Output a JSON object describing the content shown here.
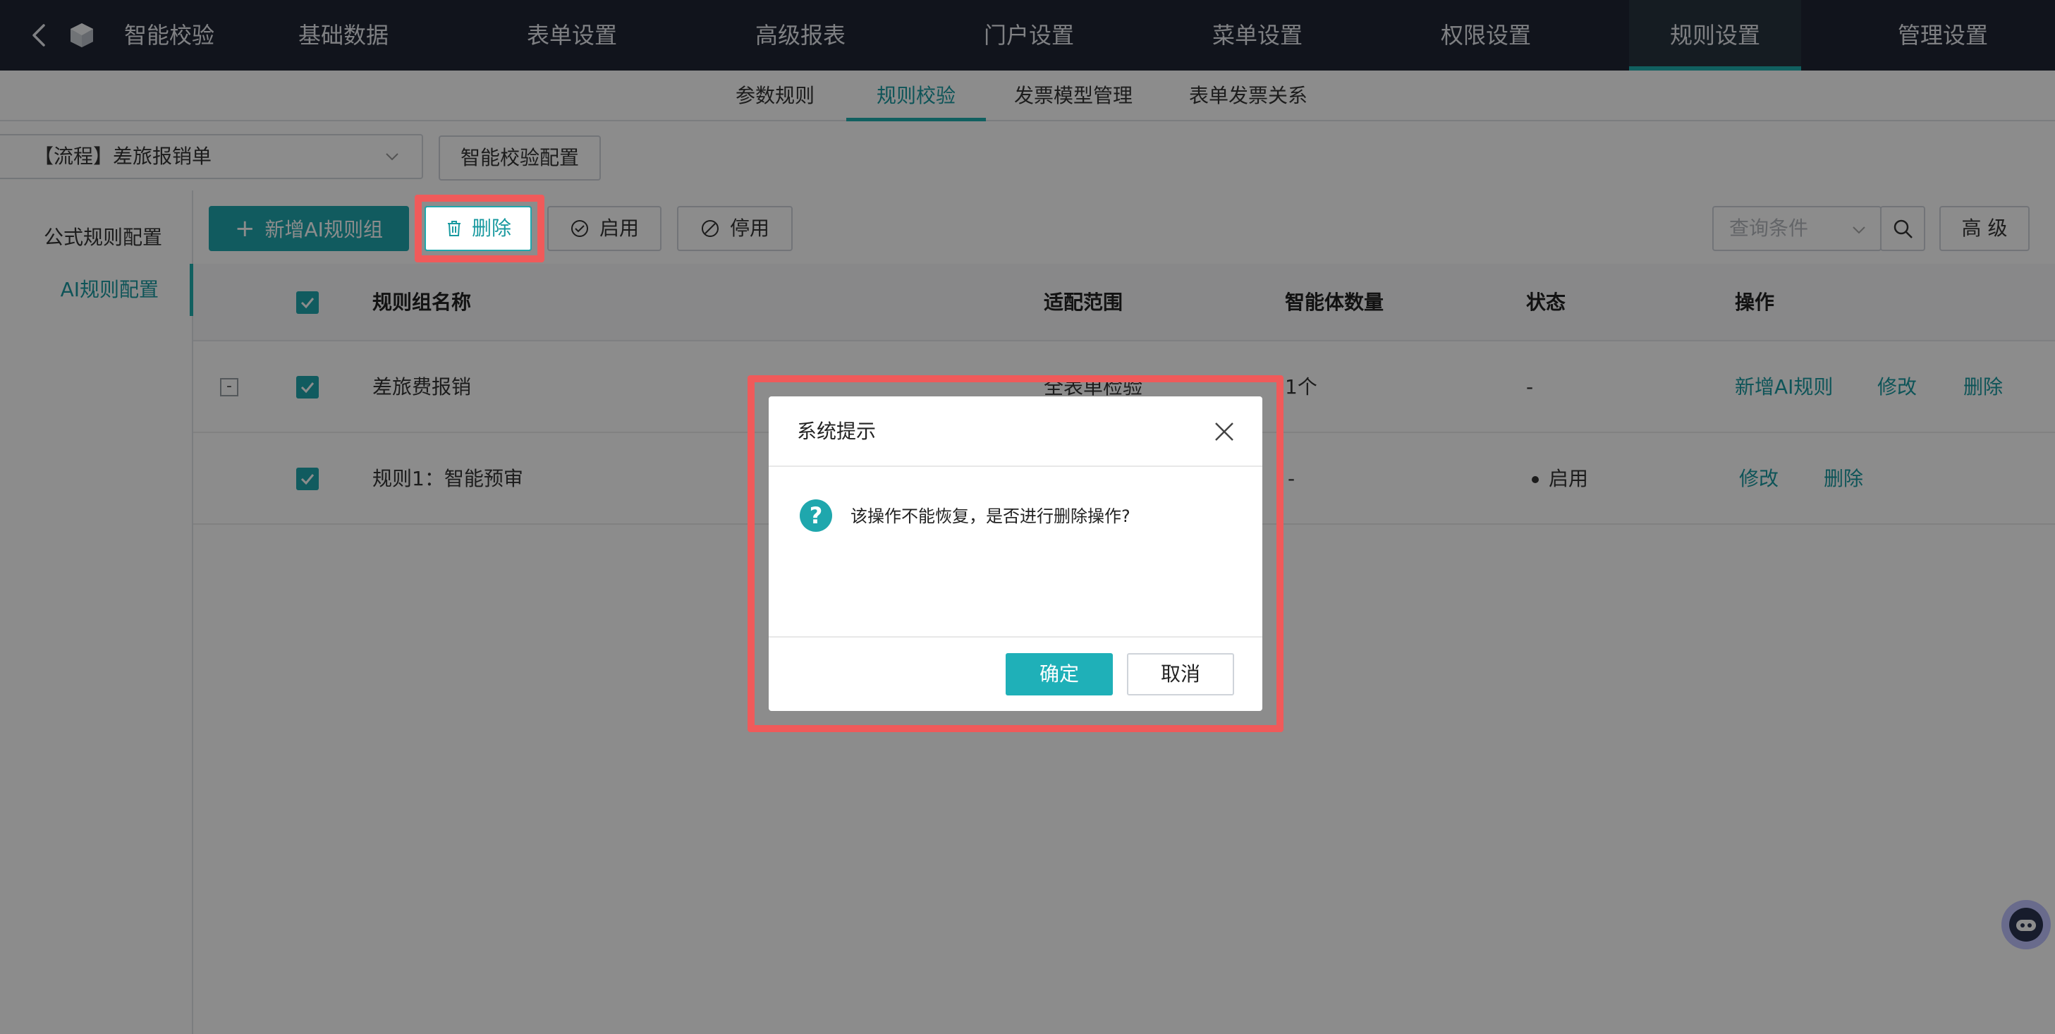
{
  "app": {
    "title": "智能校验"
  },
  "topnav": {
    "items": [
      "基础数据",
      "表单设置",
      "高级报表",
      "门户设置",
      "菜单设置",
      "权限设置",
      "规则设置",
      "管理设置"
    ],
    "active": "规则设置"
  },
  "subtabs": {
    "items": [
      "参数规则",
      "规则校验",
      "发票模型管理",
      "表单发票关系"
    ],
    "active": "规则校验"
  },
  "flow_select": {
    "value": "【流程】差旅报销单"
  },
  "config_button": {
    "label": "智能校验配置"
  },
  "sidebar": {
    "items": [
      "公式规则配置",
      "AI规则配置"
    ],
    "active": "AI规则配置"
  },
  "toolbar": {
    "add_label": "新增AI规则组",
    "delete_label": "删除",
    "enable_label": "启用",
    "disable_label": "停用",
    "search_placeholder": "查询条件",
    "advanced_label": "高 级"
  },
  "table": {
    "headers": [
      "规则组名称",
      "适配范围",
      "智能体数量",
      "状态",
      "操作"
    ],
    "rows": [
      {
        "expander": "-",
        "name": "差旅费报销",
        "scope": "全表单检验",
        "count": "1个",
        "status": "-",
        "actions": [
          "新增AI规则",
          "修改",
          "删除"
        ]
      },
      {
        "name": "规则1：智能预审",
        "scope": "",
        "count": "-",
        "status": "启用",
        "actions": [
          "修改",
          "删除"
        ]
      }
    ]
  },
  "dialog": {
    "title": "系统提示",
    "message": "该操作不能恢复，是否进行删除操作?",
    "icon_glyph": "?",
    "confirm_label": "确定",
    "cancel_label": "取消"
  },
  "colors": {
    "accent": "#1fa7ad",
    "nav_bg": "#1f2634",
    "highlight": "#f05a5a"
  }
}
